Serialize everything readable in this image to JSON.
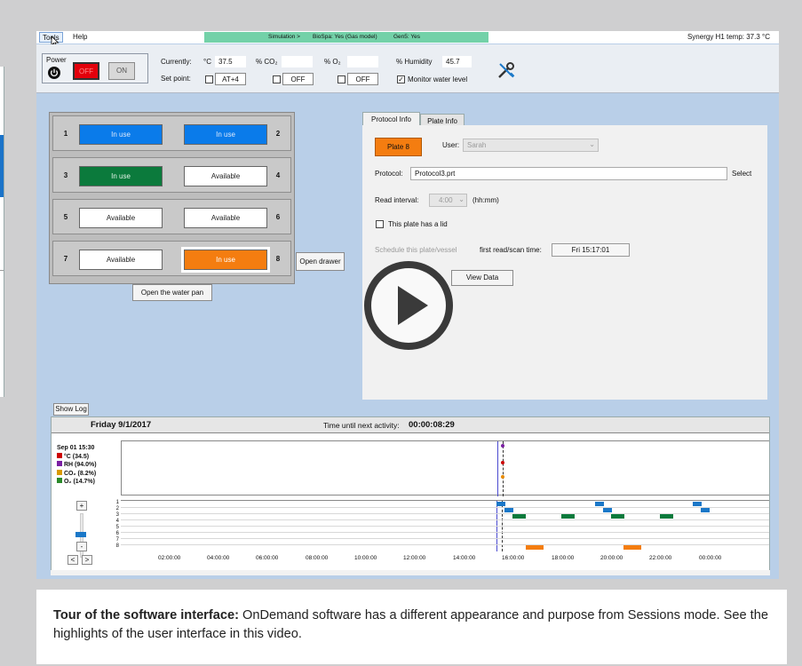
{
  "menu": {
    "tools": "Tools",
    "help": "Help"
  },
  "simulation_bar": {
    "simulation": "Simulation >",
    "biospa": "BioSpa: Yes (Gas model)",
    "gen5": "Gen5: Yes"
  },
  "synergy_temp": "Synergy H1 temp: 37.3 °C",
  "power": {
    "label": "Power",
    "off": "OFF",
    "on": "ON"
  },
  "environment": {
    "currently_label": "Currently:",
    "setpoint_label": "Set point:",
    "temp_unit": "°C",
    "temp_current": "37.5",
    "temp_setpoint": "AT+4",
    "co2_label": "% CO₂",
    "co2_current": "",
    "co2_setpoint": "OFF",
    "o2_label": "% O₂",
    "o2_current": "",
    "o2_setpoint": "OFF",
    "humidity_label": "% Humidity",
    "humidity_current": "45.7",
    "monitor_water_label": "Monitor water level",
    "monitor_water_checked": true,
    "tools_icon": "wrench-screwdriver-icon"
  },
  "plates": {
    "slots": [
      {
        "number": "1",
        "status": "In use",
        "color": "#0a7bea"
      },
      {
        "number": "2",
        "status": "In use",
        "color": "#0a7bea"
      },
      {
        "number": "3",
        "status": "In use",
        "color": "#0b7a3c"
      },
      {
        "number": "4",
        "status": "Available",
        "color": "#ffffff"
      },
      {
        "number": "5",
        "status": "Available",
        "color": "#ffffff"
      },
      {
        "number": "6",
        "status": "Available",
        "color": "#ffffff"
      },
      {
        "number": "7",
        "status": "Available",
        "color": "#ffffff"
      },
      {
        "number": "8",
        "status": "In use",
        "color": "#f47d10"
      }
    ],
    "open_drawer": "Open drawer",
    "open_water_pan": "Open the water pan"
  },
  "info_panel": {
    "tabs": [
      "Protocol Info",
      "Plate Info"
    ],
    "active_tab": "Protocol Info",
    "plate_button": "Plate 8",
    "user_label": "User:",
    "user_value": "Sarah",
    "protocol_label": "Protocol:",
    "protocol_value": "Protocol3.prt",
    "select_label": "Select",
    "read_interval_label": "Read interval:",
    "read_interval_value": "4:00",
    "read_interval_unit": "(hh:mm)",
    "lid_label": "This plate has a lid",
    "schedule_label": "Schedule this plate/vessel",
    "first_read_label": "first read/scan time:",
    "first_read_value": "Fri 15:17:01",
    "view_data": "View Data"
  },
  "show_log": "Show Log",
  "timeline": {
    "date": "Friday 9/1/2017",
    "next_activity_label": "Time until next activity:",
    "next_activity_value": "00:00:08:29",
    "legend": {
      "timestamp": "Sep 01 15:30",
      "items": [
        {
          "label": "°C",
          "value": "(34.5)"
        },
        {
          "label": "RH",
          "value": "(94.0%)"
        },
        {
          "label": "CO₂",
          "value": "(8.2%)"
        },
        {
          "label": "O₂",
          "value": "(14.7%)"
        }
      ]
    },
    "rows": [
      "1",
      "2",
      "3",
      "4",
      "5",
      "6",
      "7",
      "8"
    ],
    "times": [
      "02:00:00",
      "04:00:00",
      "06:00:00",
      "08:00:00",
      "10:00:00",
      "12:00:00",
      "14:00:00",
      "16:00:00",
      "18:00:00",
      "20:00:00",
      "22:00:00",
      "00:00:00"
    ],
    "zoom_in": "+",
    "zoom_out": "-",
    "nav_left": "<",
    "nav_right": ">"
  },
  "caption": {
    "bold": "Tour of the software interface:",
    "text": " OnDemand software has a different appearance and purpose from Sessions mode. See the highlights of the user interface in this video."
  },
  "play_icon": "play-button-icon"
}
